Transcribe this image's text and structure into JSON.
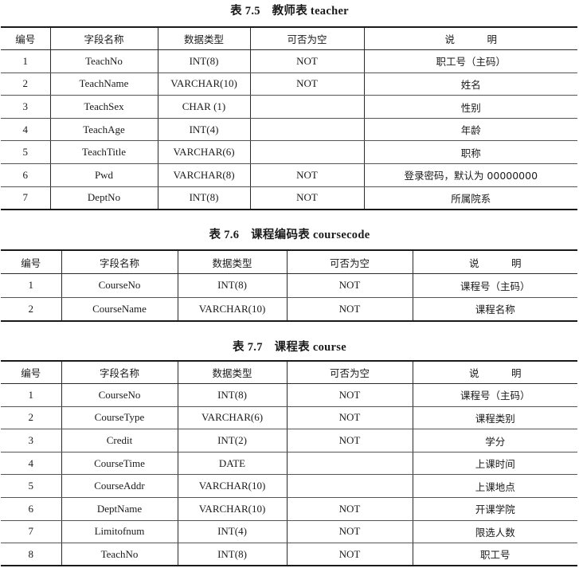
{
  "tables": [
    {
      "caption": "表 7.5　教师表 teacher",
      "headers": [
        "编号",
        "字段名称",
        "数据类型",
        "可否为空",
        "说　明"
      ],
      "rows": [
        [
          "1",
          "TeachNo",
          "INT(8)",
          "NOT",
          "职工号（主码）"
        ],
        [
          "2",
          "TeachName",
          "VARCHAR(10)",
          "NOT",
          "姓名"
        ],
        [
          "3",
          "TeachSex",
          "CHAR (1)",
          "",
          "性别"
        ],
        [
          "4",
          "TeachAge",
          "INT(4)",
          "",
          "年龄"
        ],
        [
          "5",
          "TeachTitle",
          "VARCHAR(6)",
          "",
          "职称"
        ],
        [
          "6",
          "Pwd",
          "VARCHAR(8)",
          "NOT",
          "登录密码，默认为 00000000"
        ],
        [
          "7",
          "DeptNo",
          "INT(8)",
          "NOT",
          "所属院系"
        ]
      ]
    },
    {
      "caption": "表 7.6　课程编码表 coursecode",
      "headers": [
        "编号",
        "字段名称",
        "数据类型",
        "可否为空",
        "说　明"
      ],
      "rows": [
        [
          "1",
          "CourseNo",
          "INT(8)",
          "NOT",
          "课程号（主码）"
        ],
        [
          "2",
          "CourseName",
          "VARCHAR(10)",
          "NOT",
          "课程名称"
        ]
      ]
    },
    {
      "caption": "表 7.7　课程表 course",
      "headers": [
        "编号",
        "字段名称",
        "数据类型",
        "可否为空",
        "说　明"
      ],
      "rows": [
        [
          "1",
          "CourseNo",
          "INT(8)",
          "NOT",
          "课程号（主码）"
        ],
        [
          "2",
          "CourseType",
          "VARCHAR(6)",
          "NOT",
          "课程类别"
        ],
        [
          "3",
          "Credit",
          "INT(2)",
          "NOT",
          "学分"
        ],
        [
          "4",
          "CourseTime",
          "DATE",
          "",
          "上课时间"
        ],
        [
          "5",
          "CourseAddr",
          "VARCHAR(10)",
          "",
          "上课地点"
        ],
        [
          "6",
          "DeptName",
          "VARCHAR(10)",
          "NOT",
          "开课学院"
        ],
        [
          "7",
          "Limitofnum",
          "INT(4)",
          "NOT",
          "限选人数"
        ],
        [
          "8",
          "TeachNo",
          "INT(8)",
          "NOT",
          "职工号"
        ]
      ]
    }
  ]
}
